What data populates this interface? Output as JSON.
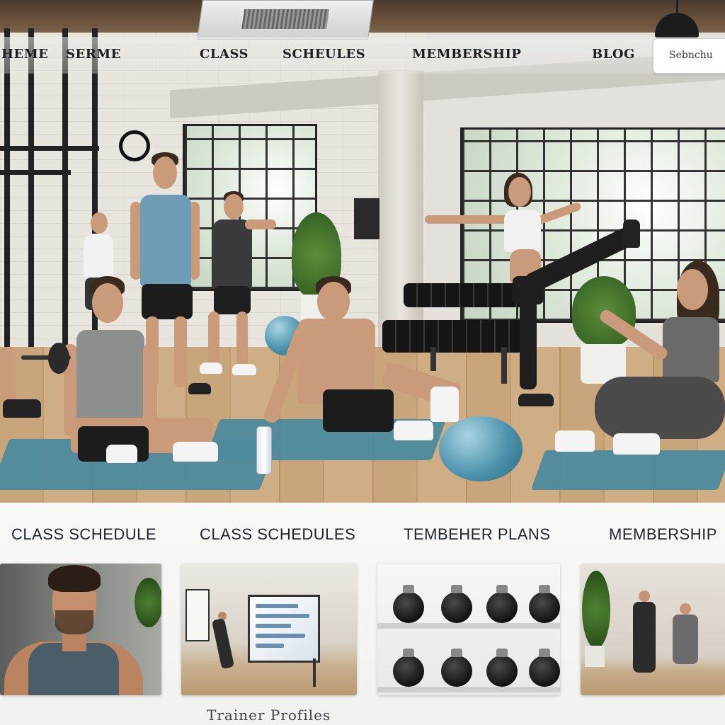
{
  "nav": {
    "items": [
      {
        "label": "HEME"
      },
      {
        "label": "SERME"
      },
      {
        "label": "CLASS"
      },
      {
        "label": "SCHEULES"
      },
      {
        "label": "MEMBERSHIP"
      },
      {
        "label": "BLOG"
      }
    ],
    "search": {
      "label": "Sebnchu"
    }
  },
  "sections": {
    "titles": [
      {
        "label": "CLASS SCHEDULE"
      },
      {
        "label": "CLASS SCHEDULES"
      },
      {
        "label": "TEMBEHER PLANS"
      },
      {
        "label": "MEMBERSHIP"
      }
    ],
    "caption": "Trainer Profiles"
  },
  "colors": {
    "mat": "#4d8a9c",
    "ball": "#4e93ad",
    "nav_text": "#1e1e22",
    "section_text": "#1d2430"
  },
  "icons": {
    "lamp": "pendant-lamp-icon",
    "ac": "air-conditioner-icon"
  }
}
